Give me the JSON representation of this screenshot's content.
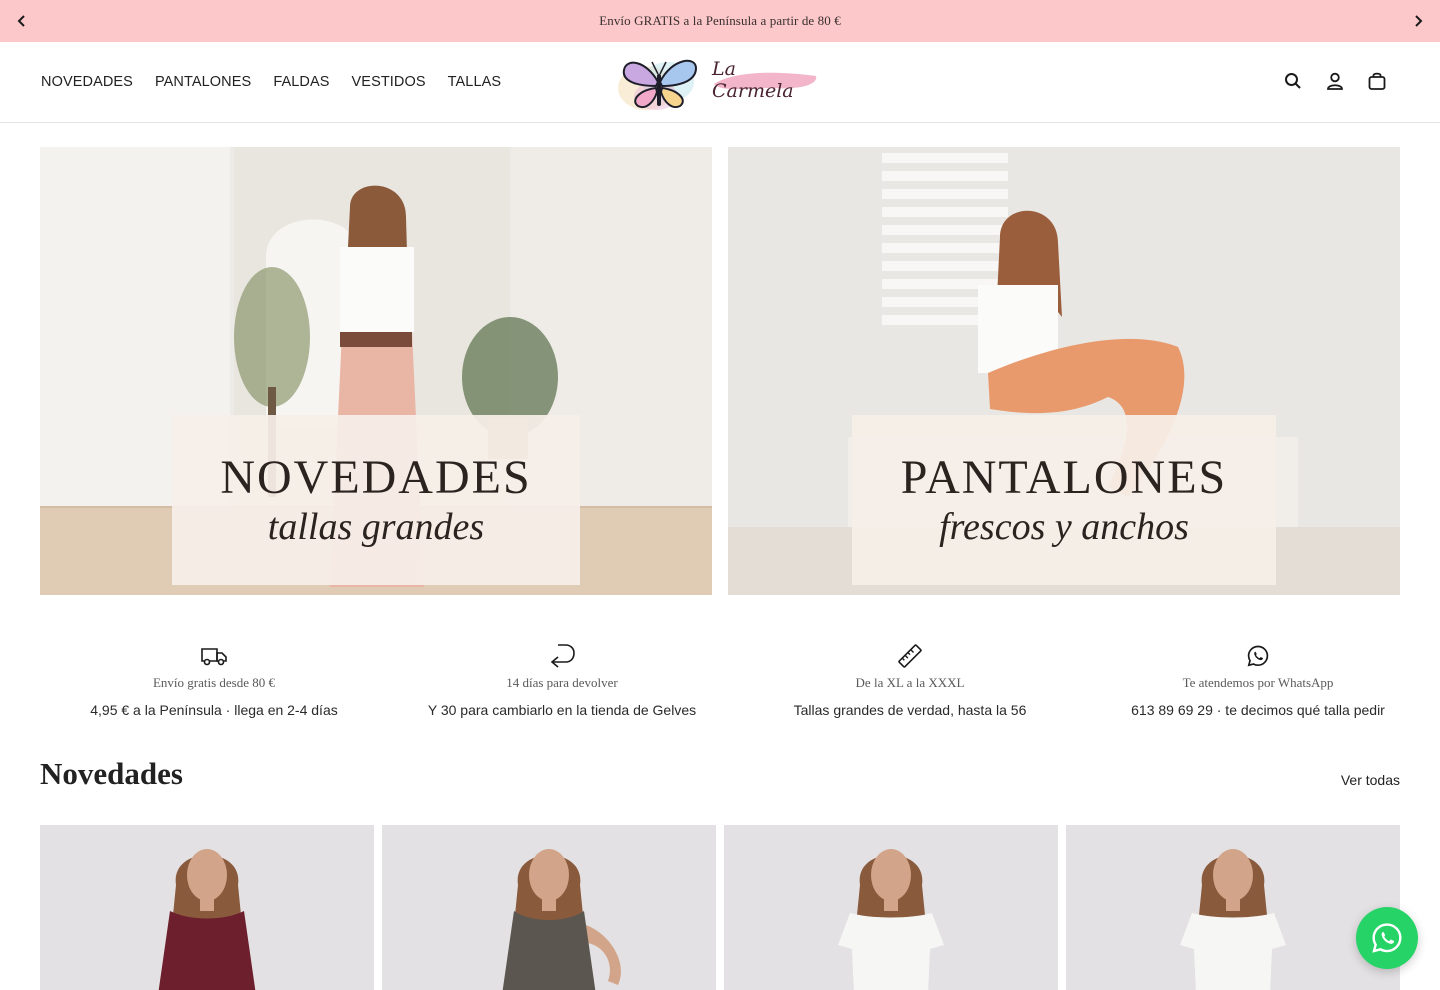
{
  "announcement": {
    "text": "Envío GRATIS a la Península a partir de 80 €",
    "bg_color": "#fcc8ca"
  },
  "nav": {
    "items": [
      "NOVEDADES",
      "PANTALONES",
      "FALDAS",
      "VESTIDOS",
      "TALLAS"
    ]
  },
  "logo": {
    "wordmark": "La Carmela",
    "icon": "butterfly-icon"
  },
  "header_icons": [
    "search-icon",
    "account-icon",
    "cart-icon"
  ],
  "heroes": [
    {
      "title": "NOVEDADES",
      "subtitle": "tallas grandes"
    },
    {
      "title": "PANTALONES",
      "subtitle": "frescos y anchos"
    }
  ],
  "benefits": [
    {
      "icon": "truck-icon",
      "title": "Envío gratis desde 80 €",
      "text": "4,95 € a la Península · llega en 2-4 días"
    },
    {
      "icon": "return-arrow-icon",
      "title": "14 días para devolver",
      "text": "Y 30 para cambiarlo en la tienda de Gelves"
    },
    {
      "icon": "ruler-icon",
      "title": "De la XL a la XXXL",
      "text": "Tallas grandes de verdad, hasta la 56"
    },
    {
      "icon": "whatsapp-icon",
      "title": "Te atendemos por WhatsApp",
      "text": "613 89 69 29 · te decimos qué talla pedir"
    }
  ],
  "section": {
    "title": "Novedades",
    "link": "Ver todas"
  },
  "products": [
    {
      "garment_color": "#6e1f2e"
    },
    {
      "garment_color": "#5b5650"
    },
    {
      "garment_color": "#f6f6f4"
    },
    {
      "garment_color": "#f6f6f4"
    }
  ],
  "floating_button": {
    "icon": "whatsapp-icon",
    "color": "#25d366"
  }
}
